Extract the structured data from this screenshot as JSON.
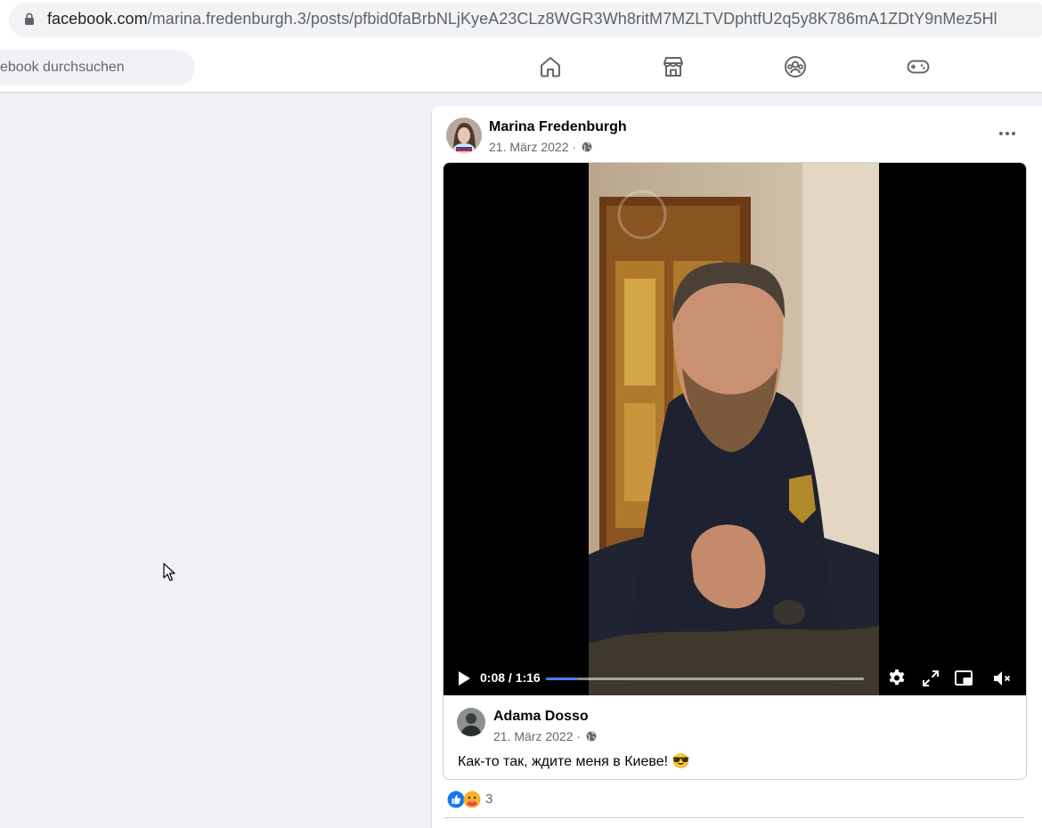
{
  "browser": {
    "url_host": "facebook.com",
    "url_path": "/marina.fredenburgh.3/posts/pfbid0faBrbNLjKyeA23CLz8WGR3Wh8ritM7MZLTVDphtfU2q5y8K786mA1ZDtY9nMez5Hl"
  },
  "header": {
    "search_placeholder": "ebook durchsuchen",
    "nav": [
      "home-icon",
      "marketplace-icon",
      "groups-icon",
      "gaming-icon"
    ]
  },
  "post": {
    "author": "Marina Fredenburgh",
    "date": "21. März 2022 ·",
    "privacy_icon": "globe-icon",
    "shared": {
      "video": {
        "time": "0:08 / 1:16",
        "progress": 0.1
      },
      "author": "Adama Dosso",
      "date": "21. März 2022 ·",
      "text": "Как-то так, ждите меня в Киеве! 😎"
    },
    "reactions": {
      "icons": [
        "like-icon",
        "care-icon"
      ],
      "count": "3"
    }
  },
  "colors": {
    "accent": "#1877f2",
    "progress": "#4a7cf5",
    "background": "#f0f2f5"
  }
}
